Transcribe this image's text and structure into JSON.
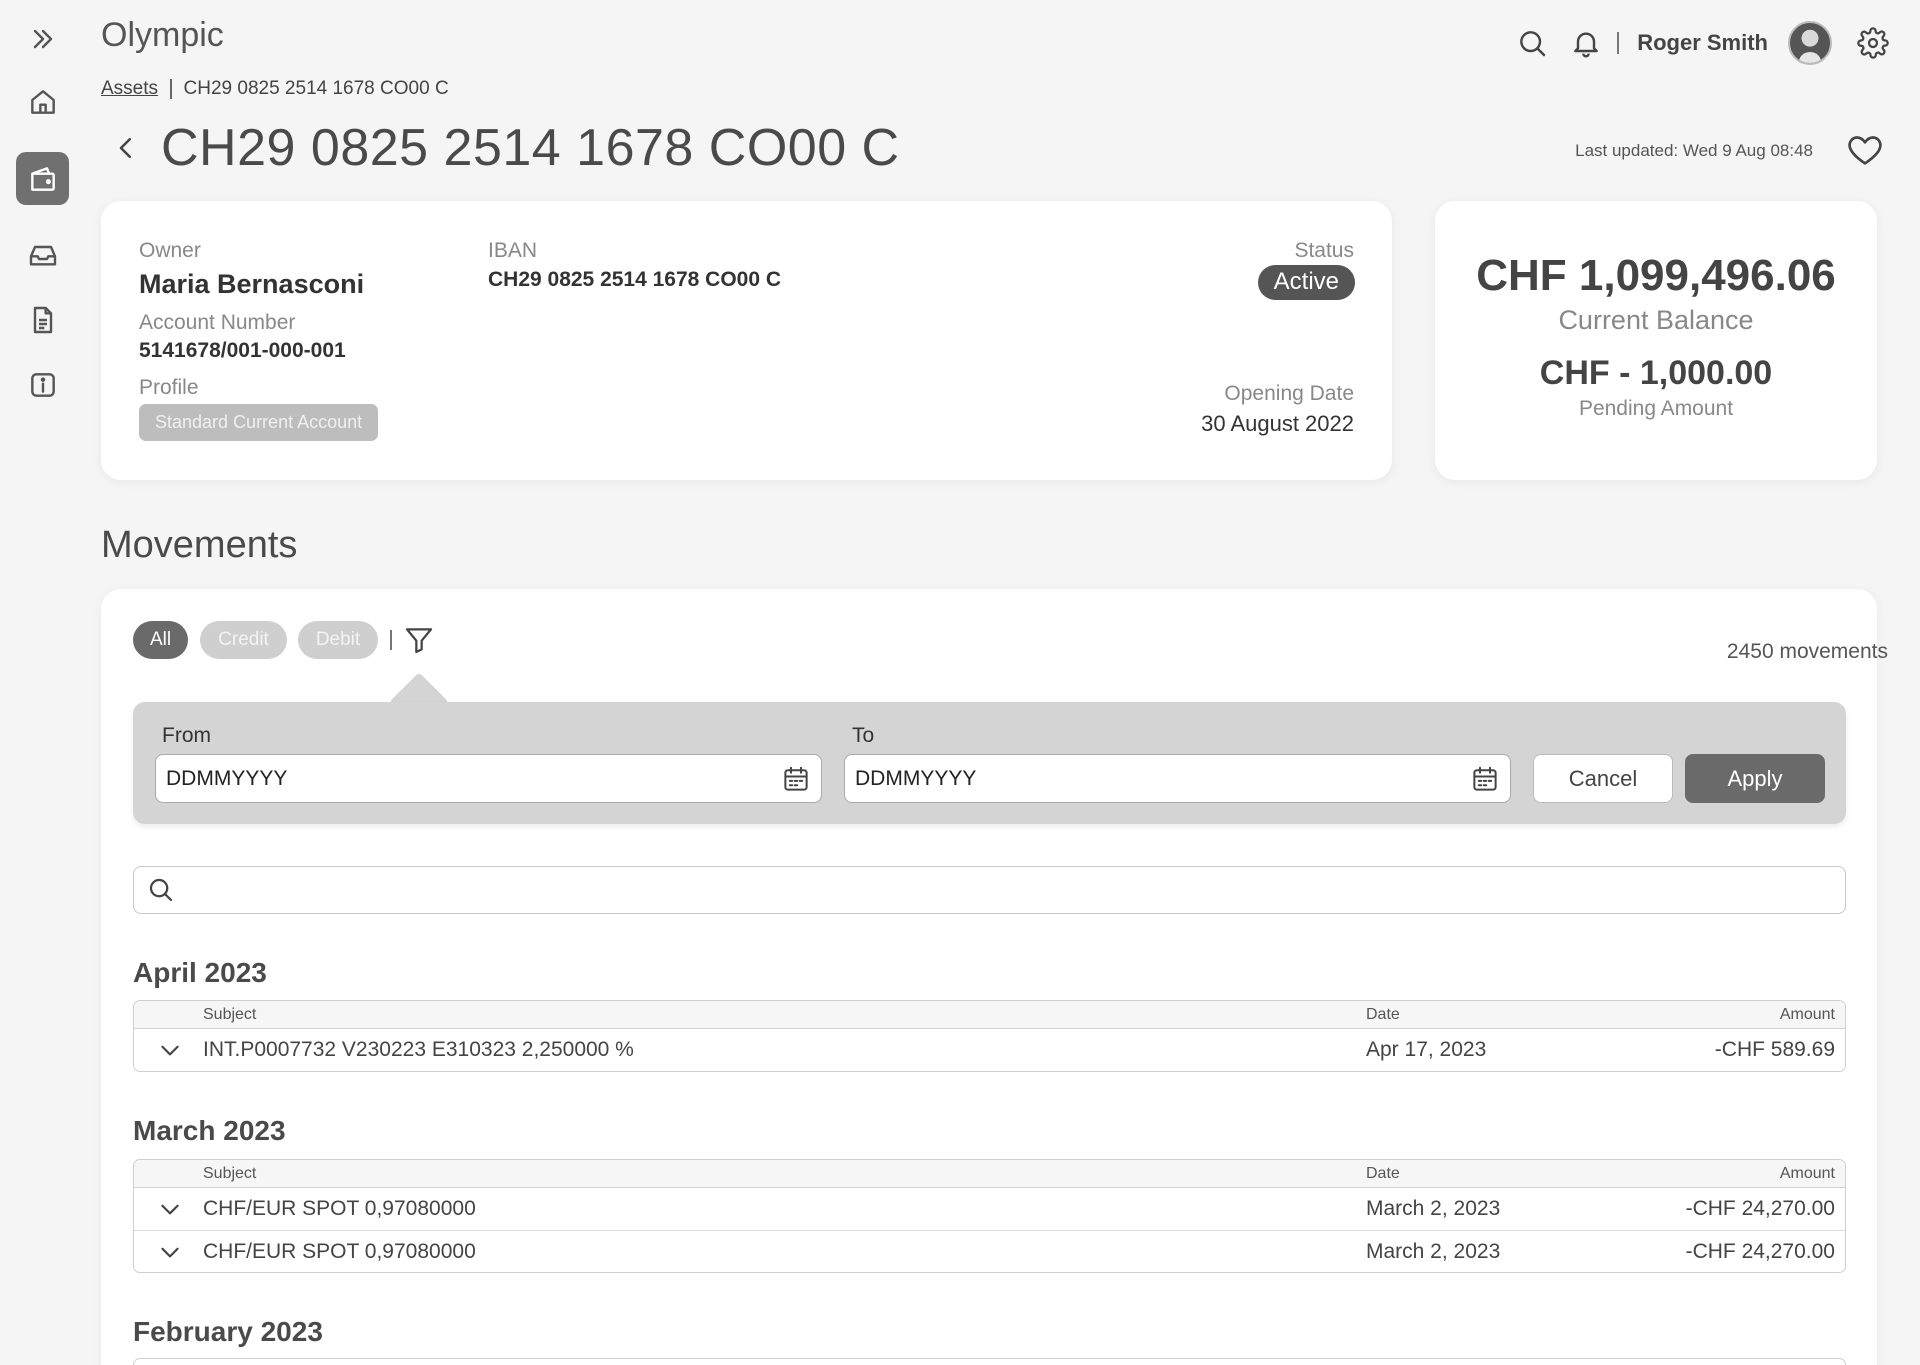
{
  "app": {
    "title": "Olympic"
  },
  "header": {
    "user_name": "Roger Smith",
    "icons": [
      "search-icon",
      "bell-icon",
      "avatar",
      "gear-icon"
    ]
  },
  "sidebar": {
    "items": [
      {
        "icon": "expand-chevrons-icon"
      },
      {
        "icon": "home-icon"
      },
      {
        "icon": "wallet-icon",
        "active": true
      },
      {
        "icon": "inbox-icon"
      },
      {
        "icon": "document-icon"
      },
      {
        "icon": "info-icon"
      }
    ]
  },
  "breadcrumb": {
    "root": "Assets",
    "current": "CH29 0825 2514 1678 CO00 C"
  },
  "page": {
    "title": "CH29 0825 2514 1678 CO00 C",
    "last_updated": "Last updated: Wed 9 Aug 08:48"
  },
  "account": {
    "owner_label": "Owner",
    "owner": "Maria Bernasconi",
    "account_number_label": "Account Number",
    "account_number": "5141678/001-000-001",
    "profile_label": "Profile",
    "profile": "Standard Current Account",
    "iban_label": "IBAN",
    "iban": "CH29 0825 2514 1678 CO00 C",
    "status_label": "Status",
    "status": "Active",
    "opening_date_label": "Opening Date",
    "opening_date": "30 August 2022"
  },
  "balance": {
    "current": "CHF 1,099,496.06",
    "current_label": "Current Balance",
    "pending": "CHF - 1,000.00",
    "pending_label": "Pending Amount"
  },
  "movements": {
    "title": "Movements",
    "filters": [
      "All",
      "Credit",
      "Debit"
    ],
    "active_filter": "All",
    "count": "2450 movements",
    "date_filter": {
      "from_label": "From",
      "from_placeholder": "DDMMYYYY",
      "to_label": "To",
      "to_placeholder": "DDMMYYYY",
      "cancel": "Cancel",
      "apply": "Apply"
    },
    "columns": {
      "subject": "Subject",
      "date": "Date",
      "amount": "Amount"
    },
    "groups": [
      {
        "month": "April 2023",
        "rows": [
          {
            "subject": "INT.P0007732 V230223 E310323 2,250000 %",
            "date": "Apr 17, 2023",
            "amount": "-CHF 589.69"
          }
        ]
      },
      {
        "month": "March 2023",
        "rows": [
          {
            "subject": "CHF/EUR SPOT 0,97080000",
            "date": "March 2, 2023",
            "amount": "-CHF 24,270.00"
          },
          {
            "subject": "CHF/EUR SPOT 0,97080000",
            "date": "March 2, 2023",
            "amount": "-CHF 24,270.00"
          }
        ]
      },
      {
        "month": "February 2023",
        "rows": []
      }
    ]
  },
  "colors": {
    "primary": "#6a6a6a",
    "background": "#f5f5f5",
    "card": "#ffffff",
    "panel": "#d4d4d4"
  }
}
